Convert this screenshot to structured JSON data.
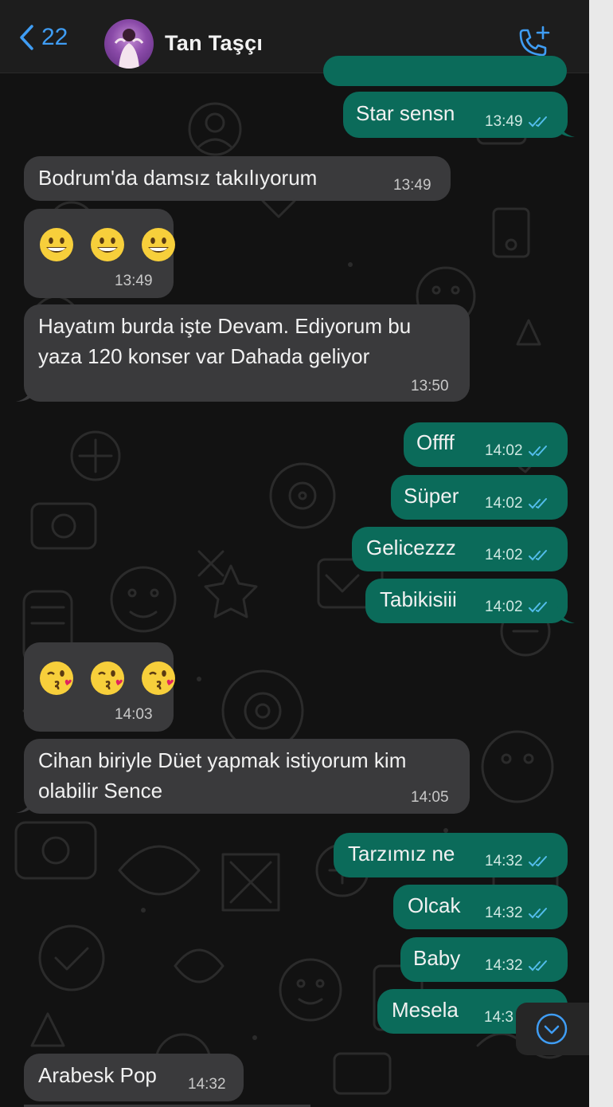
{
  "header": {
    "back_count": "22",
    "contact_name": "Tan  Taşçı"
  },
  "messages": [
    {
      "dir": "out",
      "text": "Star sensn",
      "time": "13:49",
      "read": true
    },
    {
      "dir": "in",
      "text": "Bodrum'da damsız takılıyorum",
      "time": "13:49"
    },
    {
      "dir": "in",
      "emoji": [
        "grinning-face",
        "grinning-face",
        "grinning-face"
      ],
      "time": "13:49"
    },
    {
      "dir": "in",
      "lines": [
        "Hayatım burda işte Devam. Ediyorum bu",
        "yaza 120 konser var Dahada geliyor"
      ],
      "time": "13:50"
    },
    {
      "dir": "out",
      "text": "Offff",
      "time": "14:02",
      "read": true
    },
    {
      "dir": "out",
      "text": "Süper",
      "time": "14:02",
      "read": true
    },
    {
      "dir": "out",
      "text": "Gelicezzz",
      "time": "14:02",
      "read": true
    },
    {
      "dir": "out",
      "text": "Tabikisiii",
      "time": "14:02",
      "read": true
    },
    {
      "dir": "in",
      "emoji": [
        "kissing-face",
        "kissing-face",
        "kissing-face"
      ],
      "time": "14:03"
    },
    {
      "dir": "in",
      "lines": [
        "Cihan biriyle Düet yapmak istiyorum kim",
        "olabilir Sence"
      ],
      "time": "14:05"
    },
    {
      "dir": "out",
      "text": "Tarzımız ne",
      "time": "14:32",
      "read": true
    },
    {
      "dir": "out",
      "text": "Olcak",
      "time": "14:32",
      "read": true
    },
    {
      "dir": "out",
      "text": "Baby",
      "time": "14:32",
      "read": true
    },
    {
      "dir": "out",
      "text": "Mesela",
      "time": "14:3",
      "read": true
    },
    {
      "dir": "in",
      "text": "Arabesk Pop",
      "time": "14:32"
    }
  ],
  "colors": {
    "accent": "#3f9df4",
    "outgoing_bubble": "#0b6b5a",
    "incoming_bubble": "#3a3a3c",
    "read_ticks": "#53bdeb"
  },
  "icons": [
    "chevron-left-icon",
    "add-call-icon",
    "double-check-icon",
    "chevron-down-icon"
  ]
}
